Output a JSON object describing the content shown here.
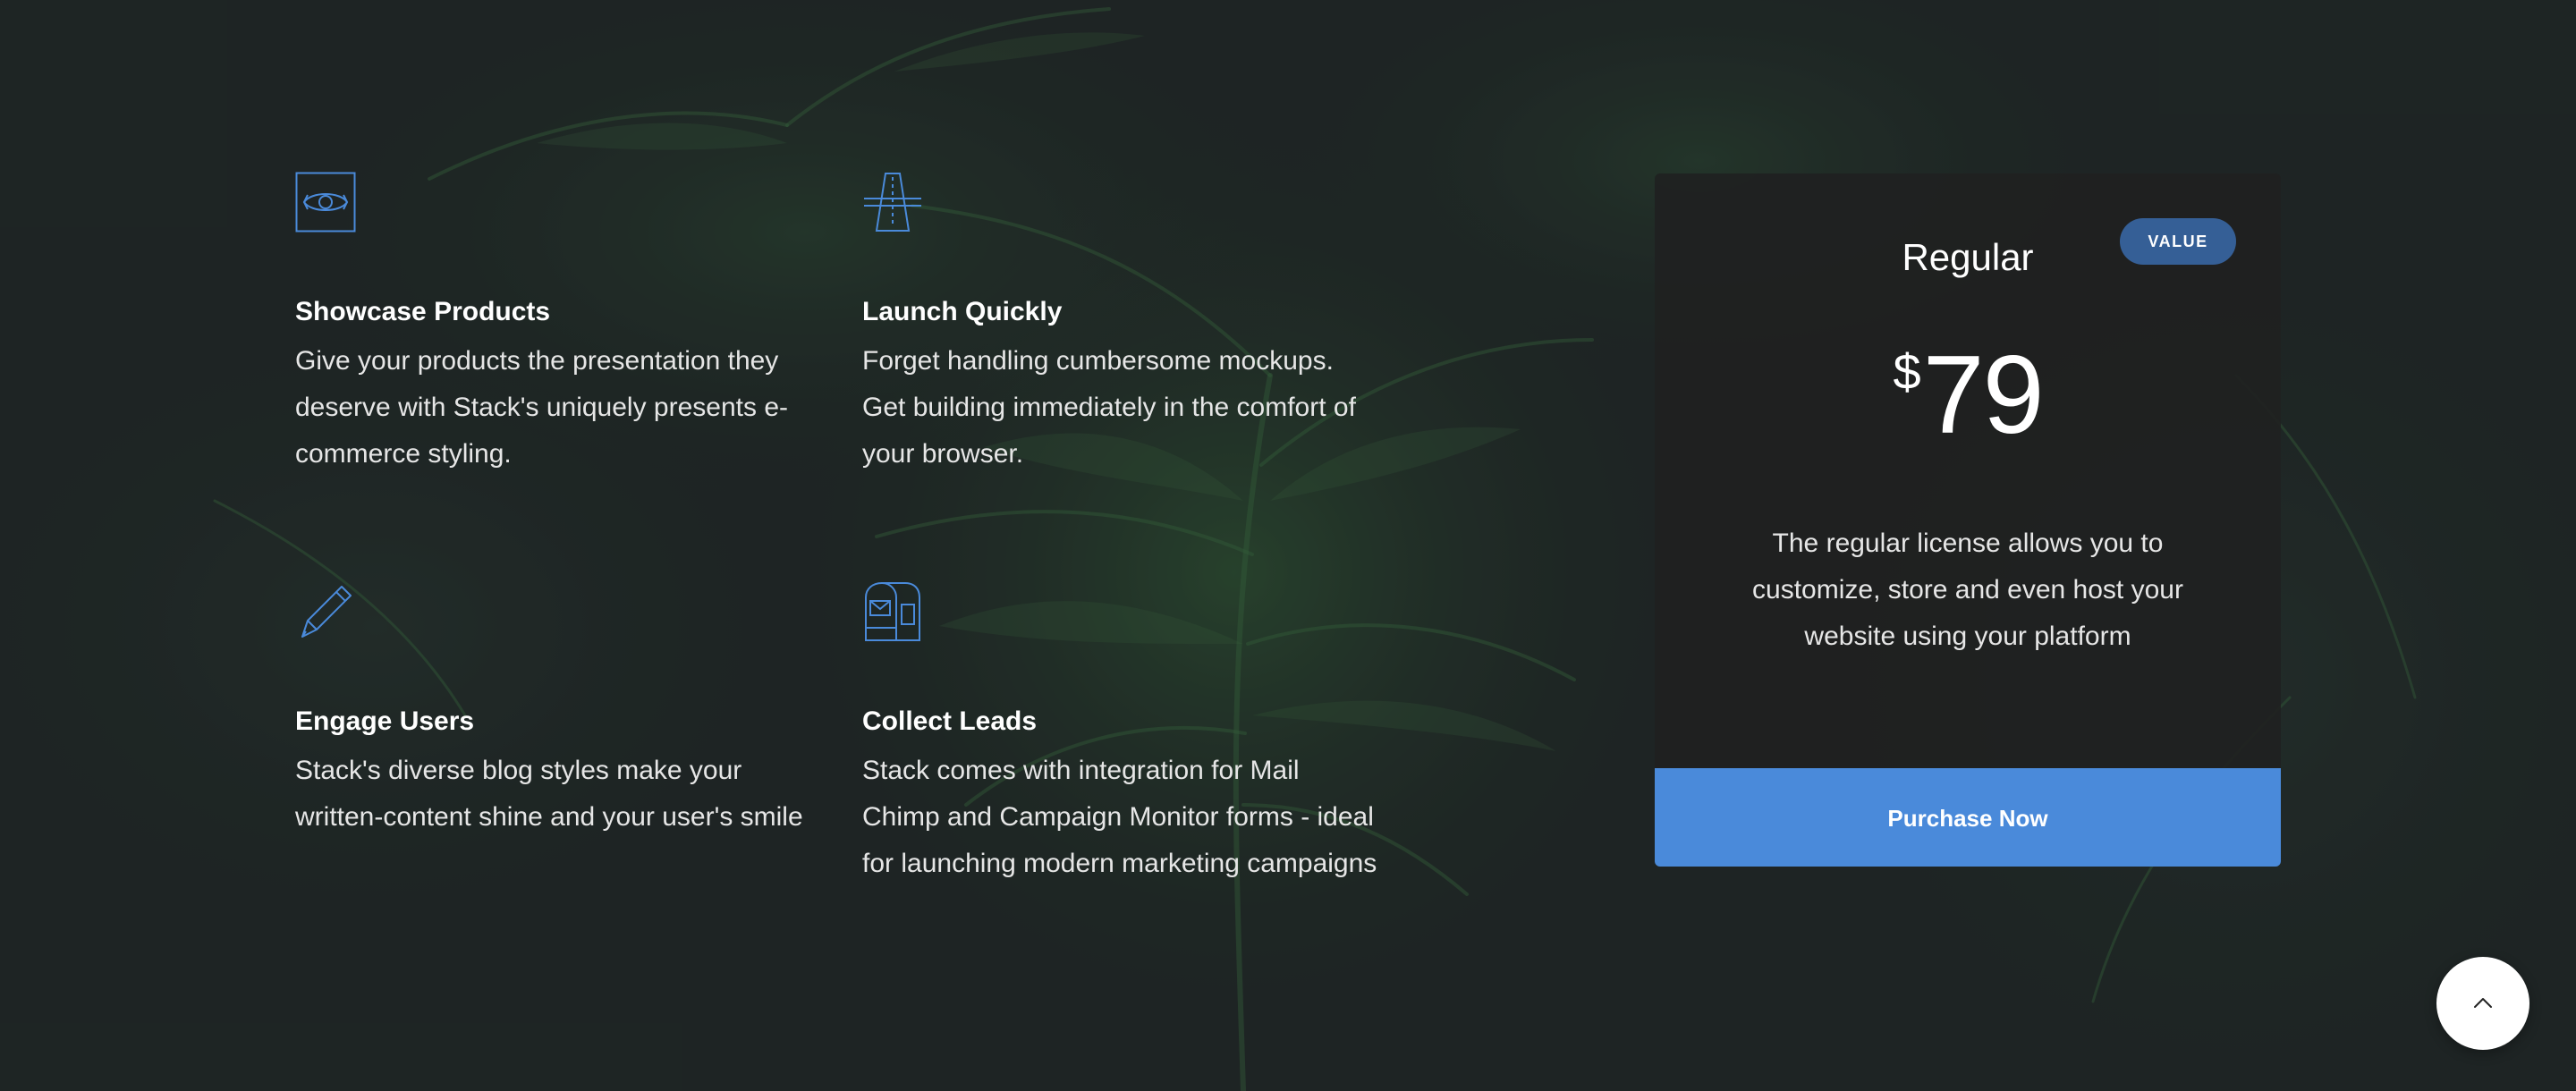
{
  "colors": {
    "background": "#1f2625",
    "accent": "#4a8ada",
    "icon": "#4a8ada",
    "badge": "#355f96",
    "card": "#202121"
  },
  "features": [
    {
      "icon": "eye-icon",
      "title": "Showcase Products",
      "description": "Give your products the presentation they deserve with Stack's uniquely presents e-commerce styling."
    },
    {
      "icon": "road-icon",
      "title": "Launch Quickly",
      "description": "Forget handling cumbersome mockups. Get building immediately in the comfort of your browser."
    },
    {
      "icon": "pen-icon",
      "title": "Engage Users",
      "description": "Stack's diverse blog styles make your written-content shine and your user's smile"
    },
    {
      "icon": "mailbox-icon",
      "title": "Collect Leads",
      "description": "Stack comes with integration for Mail Chimp and Campaign Monitor forms - ideal for launching modern marketing campaigns"
    }
  ],
  "pricing": {
    "badge": "VALUE",
    "plan_name": "Regular",
    "currency": "$",
    "price": "79",
    "description": "The regular license allows you to customize, store and even host your website using your platform",
    "button_label": "Purchase Now"
  },
  "back_to_top": {
    "icon": "chevron-up-icon"
  }
}
